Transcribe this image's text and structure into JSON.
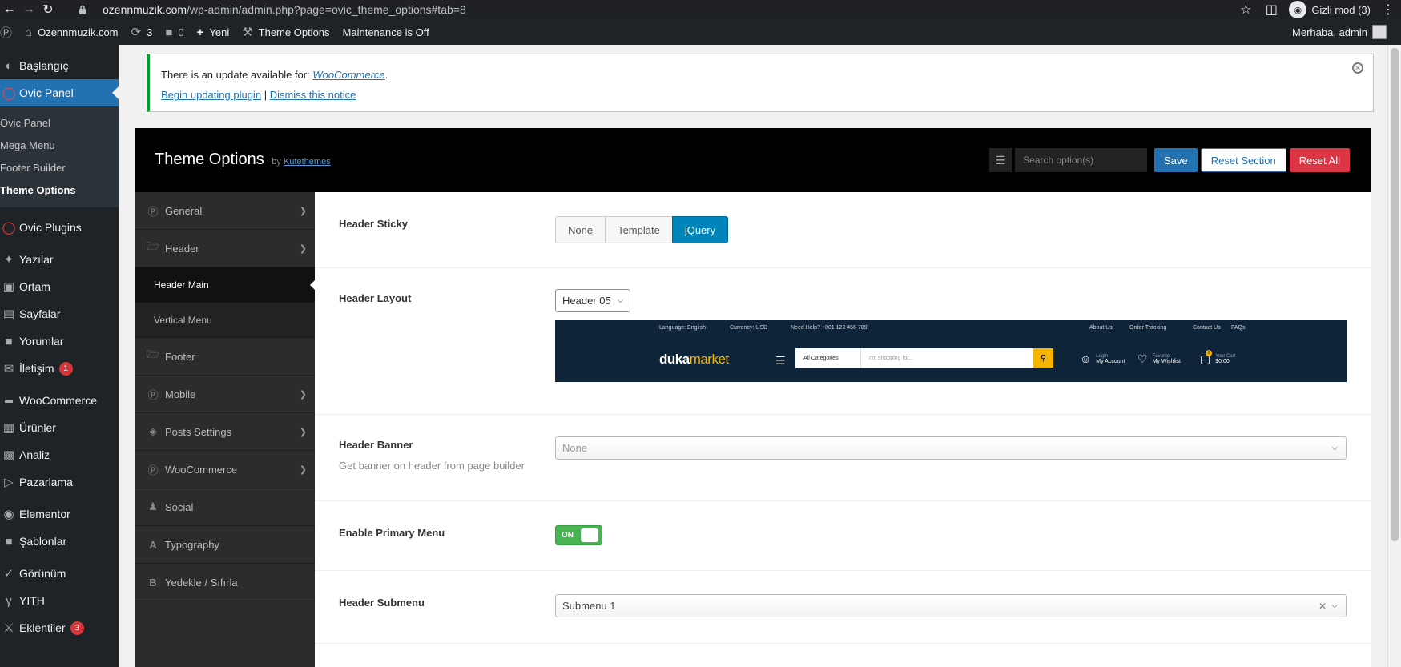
{
  "browser": {
    "url_host": "ozennmuzik.com",
    "url_path": "/wp-admin/admin.php?page=ovic_theme_options#tab=8",
    "incognito_label": "Gizli mod (3)"
  },
  "adminbar": {
    "site_name": "Ozennmuzik.com",
    "updates_count": "3",
    "comments_count": "0",
    "new_label": "Yeni",
    "theme_options_label": "Theme Options",
    "maintenance_label": "Maintenance is Off",
    "greeting": "Merhaba, admin"
  },
  "wp_menu": {
    "items": [
      {
        "label": "Başlangıç",
        "icon": "dashboard-icon"
      },
      {
        "label": "Ovic Panel",
        "icon": "ovic-icon"
      }
    ],
    "submenu": [
      "Ovic Panel",
      "Mega Menu",
      "Footer Builder",
      "Theme Options"
    ],
    "items2": [
      {
        "label": "Ovic Plugins",
        "icon": "ovic-icon"
      },
      {
        "label": "Yazılar",
        "icon": "pin-icon"
      },
      {
        "label": "Ortam",
        "icon": "media-icon"
      },
      {
        "label": "Sayfalar",
        "icon": "pages-icon"
      },
      {
        "label": "Yorumlar",
        "icon": "comments-icon"
      },
      {
        "label": "İletişim",
        "icon": "mail-icon",
        "badge": "1"
      },
      {
        "label": "WooCommerce",
        "icon": "woo-icon"
      },
      {
        "label": "Ürünler",
        "icon": "products-icon"
      },
      {
        "label": "Analiz",
        "icon": "analytics-icon"
      },
      {
        "label": "Pazarlama",
        "icon": "marketing-icon"
      },
      {
        "label": "Elementor",
        "icon": "elementor-icon"
      },
      {
        "label": "Şablonlar",
        "icon": "templates-icon"
      },
      {
        "label": "Görünüm",
        "icon": "appearance-icon"
      },
      {
        "label": "YITH",
        "icon": "yith-icon"
      },
      {
        "label": "Eklentiler",
        "icon": "plugins-icon",
        "badge": "3"
      }
    ]
  },
  "notice": {
    "text": "There is an update available for:",
    "plugin": "WooCommerce",
    "begin_link": "Begin updating plugin",
    "separator": "|",
    "dismiss_link": "Dismiss this notice"
  },
  "theme_options": {
    "title": "Theme Options",
    "by": "by",
    "author": "Kutethemes",
    "search_placeholder": "Search option(s)",
    "save": "Save",
    "reset_section": "Reset Section",
    "reset_all": "Reset All"
  },
  "nav": {
    "general": "General",
    "header": "Header",
    "header_main": "Header Main",
    "vertical_menu": "Vertical Menu",
    "footer": "Footer",
    "mobile": "Mobile",
    "posts_settings": "Posts Settings",
    "woocommerce": "WooCommerce",
    "social": "Social",
    "typography": "Typography",
    "backup": "Yedekle / Sıfırla"
  },
  "fields": {
    "header_sticky": {
      "label": "Header Sticky",
      "options": [
        "None",
        "Template",
        "jQuery"
      ],
      "selected": "jQuery"
    },
    "header_layout": {
      "label": "Header Layout",
      "value": "Header 05"
    },
    "header_banner": {
      "label": "Header Banner",
      "desc": "Get banner on header from page builder",
      "value": "None"
    },
    "enable_primary_menu": {
      "label": "Enable Primary Menu",
      "state": "ON"
    },
    "header_submenu": {
      "label": "Header Submenu",
      "value": "Submenu 1"
    }
  },
  "preview": {
    "language": "Language: English",
    "currency": "Currency: USD",
    "help": "Need Help? +001 123 456 789",
    "about": "About Us",
    "tracking": "Order Tracking",
    "contact": "Contact Us",
    "faqs": "FAQs",
    "logo_a": "duka",
    "logo_b": "market",
    "categories": "All Categories",
    "search_ph": "I'm shopping for...",
    "login": "Login",
    "account": "My Account",
    "favorite": "Favorite",
    "wishlist": "My Wishlist",
    "cart_label": "Your Cart",
    "cart_value": "$0.00",
    "cart_count": "0"
  }
}
